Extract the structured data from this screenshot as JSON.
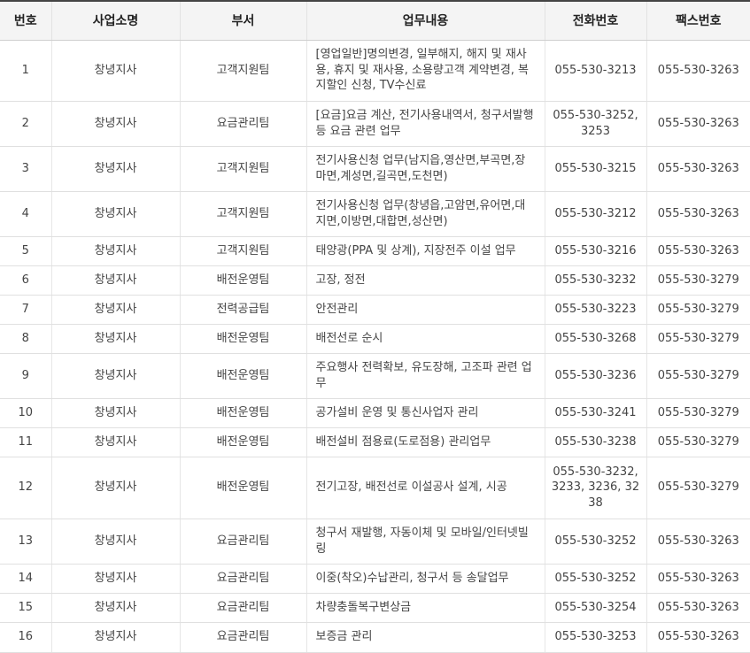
{
  "headers": [
    "번호",
    "사업소명",
    "부서",
    "업무내용",
    "전화번호",
    "팩스번호"
  ],
  "rows": [
    {
      "no": "1",
      "office": "창녕지사",
      "dept": "고객지원팀",
      "task": "[영업일반]명의변경, 일부해지, 해지 및 재사용, 휴지 및 재사용, 소용량고객 계약변경, 복지할인 신청, TV수신료",
      "tel": "055-530-3213",
      "fax": "055-530-3263"
    },
    {
      "no": "2",
      "office": "창녕지사",
      "dept": "요금관리팀",
      "task": "[요금]요금 계산, 전기사용내역서, 청구서발행 등 요금 관련 업무",
      "tel": "055-530-3252, 3253",
      "fax": "055-530-3263"
    },
    {
      "no": "3",
      "office": "창녕지사",
      "dept": "고객지원팀",
      "task": "전기사용신청 업무(남지읍,영산면,부곡면,장마면,계성면,길곡면,도천면)",
      "tel": "055-530-3215",
      "fax": "055-530-3263"
    },
    {
      "no": "4",
      "office": "창녕지사",
      "dept": "고객지원팀",
      "task": "전기사용신청 업무(창녕읍,고암면,유어면,대지면,이방면,대합면,성산면)",
      "tel": "055-530-3212",
      "fax": "055-530-3263"
    },
    {
      "no": "5",
      "office": "창녕지사",
      "dept": "고객지원팀",
      "task": "태양광(PPA 및 상계), 지장전주 이설 업무",
      "tel": "055-530-3216",
      "fax": "055-530-3263"
    },
    {
      "no": "6",
      "office": "창녕지사",
      "dept": "배전운영팀",
      "task": "고장, 정전",
      "tel": "055-530-3232",
      "fax": "055-530-3279"
    },
    {
      "no": "7",
      "office": "창녕지사",
      "dept": "전력공급팀",
      "task": "안전관리",
      "tel": "055-530-3223",
      "fax": "055-530-3279"
    },
    {
      "no": "8",
      "office": "창녕지사",
      "dept": "배전운영팀",
      "task": "배전선로 순시",
      "tel": "055-530-3268",
      "fax": "055-530-3279"
    },
    {
      "no": "9",
      "office": "창녕지사",
      "dept": "배전운영팀",
      "task": "주요행사 전력확보, 유도장해, 고조파 관련 업무",
      "tel": "055-530-3236",
      "fax": "055-530-3279"
    },
    {
      "no": "10",
      "office": "창녕지사",
      "dept": "배전운영팀",
      "task": "공가설비 운영 및 통신사업자 관리",
      "tel": "055-530-3241",
      "fax": "055-530-3279"
    },
    {
      "no": "11",
      "office": "창녕지사",
      "dept": "배전운영팀",
      "task": "배전설비 점용료(도로점용) 관리업무",
      "tel": "055-530-3238",
      "fax": "055-530-3279"
    },
    {
      "no": "12",
      "office": "창녕지사",
      "dept": "배전운영팀",
      "task": "전기고장, 배전선로 이설공사 설계, 시공",
      "tel": "055-530-3232, 3233, 3236, 3238",
      "fax": "055-530-3279"
    },
    {
      "no": "13",
      "office": "창녕지사",
      "dept": "요금관리팀",
      "task": "청구서 재발행, 자동이체 및 모바일/인터넷빌링",
      "tel": "055-530-3252",
      "fax": "055-530-3263"
    },
    {
      "no": "14",
      "office": "창녕지사",
      "dept": "요금관리팀",
      "task": "이중(착오)수납관리, 청구서 등 송달업무",
      "tel": "055-530-3252",
      "fax": "055-530-3263"
    },
    {
      "no": "15",
      "office": "창녕지사",
      "dept": "요금관리팀",
      "task": "차량충돌복구변상금",
      "tel": "055-530-3254",
      "fax": "055-530-3263"
    },
    {
      "no": "16",
      "office": "창녕지사",
      "dept": "요금관리팀",
      "task": "보증금 관리",
      "tel": "055-530-3253",
      "fax": "055-530-3263"
    }
  ]
}
